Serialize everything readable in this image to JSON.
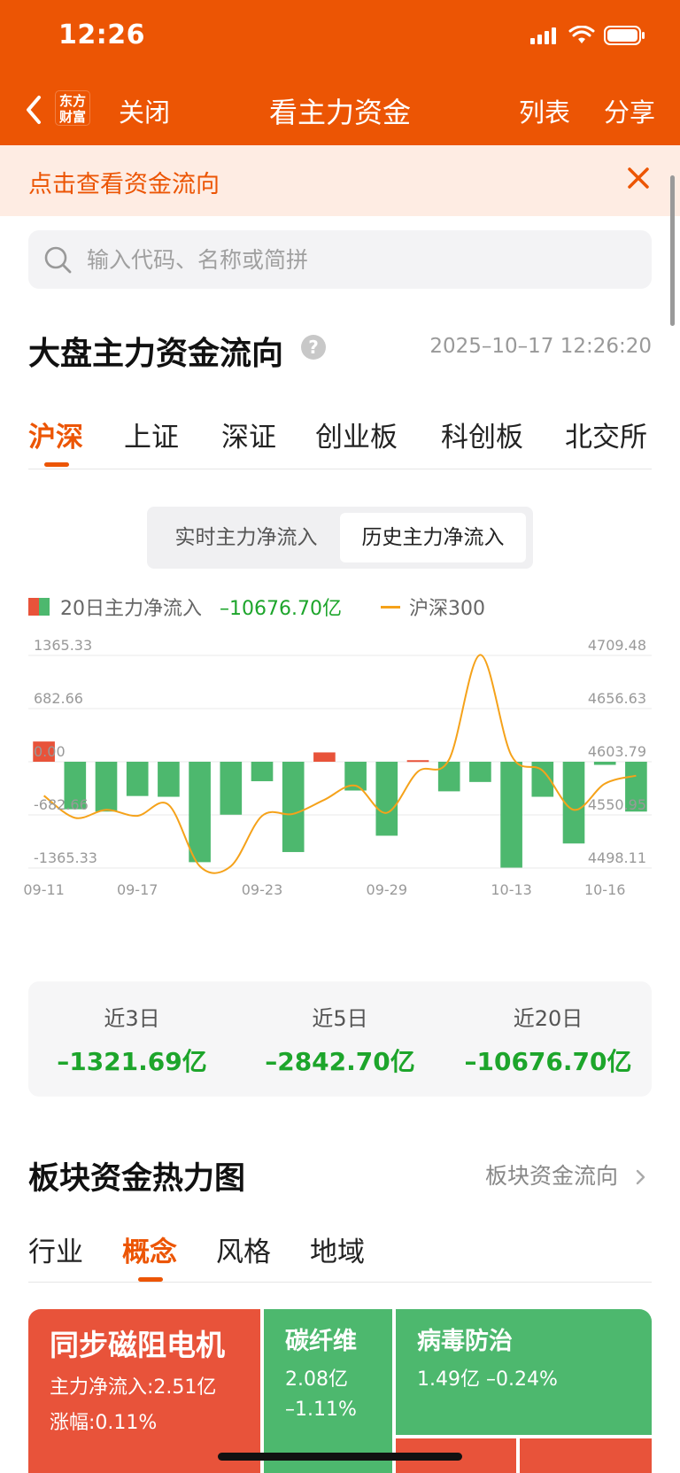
{
  "status": {
    "time": "12:26"
  },
  "nav": {
    "logo_text_1": "东方",
    "logo_text_2": "财富",
    "close": "关闭",
    "title": "看主力资金",
    "list": "列表",
    "share": "分享"
  },
  "banner": {
    "text": "点击查看资金流向"
  },
  "search": {
    "placeholder": "输入代码、名称或简拼"
  },
  "section": {
    "title": "大盘主力资金流向",
    "help": "?",
    "timestamp": "2025–10–17 12:26:20"
  },
  "market_tabs": [
    "沪深",
    "上证",
    "深证",
    "创业板",
    "科创板",
    "北交所"
  ],
  "segment": {
    "realtime": "实时主力净流入",
    "history": "历史主力净流入"
  },
  "legend": {
    "bar_label": "20日主力净流入",
    "bar_value": "–10676.70亿",
    "line_label": "沪深300"
  },
  "colors": {
    "brand": "#EC5504",
    "inflow": "#E8533A",
    "outflow": "#4DB86E",
    "index_line": "#F5A21A",
    "green_text": "#1DA52B"
  },
  "chart_data": {
    "type": "bar",
    "left_axis": {
      "ticks": [
        "1365.33",
        "682.66",
        "0.00",
        "-682.66",
        "-1365.33"
      ],
      "ylim": [
        -1365.33,
        1365.33
      ]
    },
    "right_axis": {
      "ticks": [
        "4709.48",
        "4656.63",
        "4603.79",
        "4550.95",
        "4498.11"
      ],
      "ylim": [
        4498.11,
        4709.48
      ]
    },
    "x_tick_labels": [
      {
        "label": "09-11",
        "index": 0
      },
      {
        "label": "09-17",
        "index": 3
      },
      {
        "label": "09-23",
        "index": 7
      },
      {
        "label": "09-29",
        "index": 11
      },
      {
        "label": "10-13",
        "index": 15
      },
      {
        "label": "10-16",
        "index": 18
      }
    ],
    "values": [
      260,
      -610,
      -640,
      -440,
      -450,
      -1290,
      -680,
      -250,
      -1160,
      120,
      -370,
      -950,
      20,
      -380,
      -260,
      -1360,
      -450,
      -1050,
      -40,
      -640
    ],
    "index_line": [
      4570,
      4548,
      4556,
      4550,
      4561,
      4500,
      4500,
      4550,
      4552,
      4566,
      4580,
      4553,
      4594,
      4606,
      4710,
      4610,
      4595,
      4556,
      4582,
      4590
    ]
  },
  "summary": [
    {
      "label": "近3日",
      "value": "–1321.69亿"
    },
    {
      "label": "近5日",
      "value": "–2842.70亿"
    },
    {
      "label": "近20日",
      "value": "–10676.70亿"
    }
  ],
  "heat_section": {
    "title": "板块资金热力图",
    "link": "板块资金流向"
  },
  "heat_tabs": [
    "行业",
    "概念",
    "风格",
    "地域"
  ],
  "heatmap": [
    {
      "name": "同步磁阻电机",
      "line1": "主力净流入:2.51亿",
      "line2": "涨幅:0.11%",
      "color": "#E8533A"
    },
    {
      "name": "碳纤维",
      "line1": "2.08亿",
      "line2": "–1.11%",
      "color": "#4DB86E"
    },
    {
      "name": "病毒防治",
      "line1": "1.49亿  –0.24%",
      "line2": "",
      "color": "#4DB86E"
    }
  ]
}
